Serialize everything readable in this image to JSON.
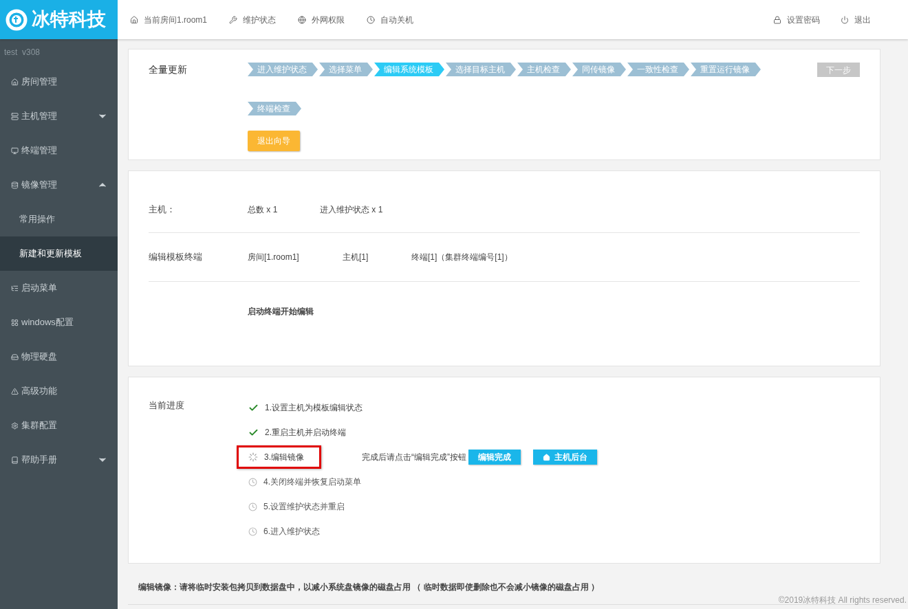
{
  "logo": {
    "text": "冰特科技"
  },
  "topnav": [
    {
      "label": "当前房间1.room1"
    },
    {
      "label": "维护状态"
    },
    {
      "label": "外网权限"
    },
    {
      "label": "自动关机"
    }
  ],
  "topright": [
    {
      "label": "设置密码"
    },
    {
      "label": "退出"
    }
  ],
  "sidebar": {
    "version": "test  v308",
    "items": [
      {
        "label": "房间管理",
        "selected": false
      },
      {
        "label": "主机管理",
        "selected": false,
        "expanded": false
      },
      {
        "label": "终端管理",
        "selected": false
      },
      {
        "label": "镜像管理",
        "selected": false,
        "expanded": true,
        "children": [
          {
            "label": "常用操作",
            "selected": false
          },
          {
            "label": "新建和更新模板",
            "selected": true
          }
        ]
      },
      {
        "label": "启动菜单",
        "selected": false
      },
      {
        "label": "windows配置",
        "selected": false
      },
      {
        "label": "物理硬盘",
        "selected": false
      },
      {
        "label": "高级功能",
        "selected": false
      },
      {
        "label": "集群配置",
        "selected": false
      },
      {
        "label": "帮助手册",
        "selected": false,
        "expanded": false
      }
    ]
  },
  "wizard": {
    "title": "全量更新",
    "steps": [
      {
        "label": "进入维护状态",
        "selected": false
      },
      {
        "label": "选择菜单",
        "selected": false
      },
      {
        "label": "编辑系统模板",
        "selected": true
      },
      {
        "label": "选择目标主机",
        "selected": false
      },
      {
        "label": "主机检查",
        "selected": false
      },
      {
        "label": "同传镜像",
        "selected": false
      },
      {
        "label": "一致性检查",
        "selected": false
      },
      {
        "label": "重置运行镜像",
        "selected": false
      },
      {
        "label": "终端检查",
        "selected": false
      }
    ],
    "next_button": {
      "label": "下一步",
      "disabled": true
    },
    "exit_button": "退出向导"
  },
  "info": {
    "host_label": "主机：",
    "host_total": "总数 x 1",
    "host_maintenance": "进入维护状态 x 1",
    "terminal_label": "编辑模板终端",
    "room": "房间[1.room1]",
    "host": "主机[1]",
    "terminal": "终端[1]（集群终端编号[1]）",
    "action": "启动终端开始编辑"
  },
  "progress": {
    "title": "当前进度",
    "steps": [
      {
        "label": "1.设置主机为模板编辑状态",
        "kind": "done",
        "highlighted": false
      },
      {
        "label": "2.重启主机并启动终端",
        "kind": "done",
        "highlighted": false
      },
      {
        "label": "3.编辑镜像",
        "kind": "active",
        "highlighted": true,
        "hint": "完成后请点击“编辑完成”按钮",
        "buttons": [
          "编辑完成",
          "主机后台"
        ]
      },
      {
        "label": "4.关闭终端并恢复启动菜单",
        "kind": "pending",
        "highlighted": false
      },
      {
        "label": "5.设置维护状态并重启",
        "kind": "pending",
        "highlighted": false
      },
      {
        "label": "6.进入维护状态",
        "kind": "pending",
        "highlighted": false
      }
    ]
  },
  "note": "编辑镜像：请将临时安装包拷贝到数据盘中，以减小系统盘镜像的磁盘占用 （ 临时数据即使删除也不会减小镜像的磁盘占用 ）",
  "copyright": "©2019冰特科技 All rights reserved."
}
